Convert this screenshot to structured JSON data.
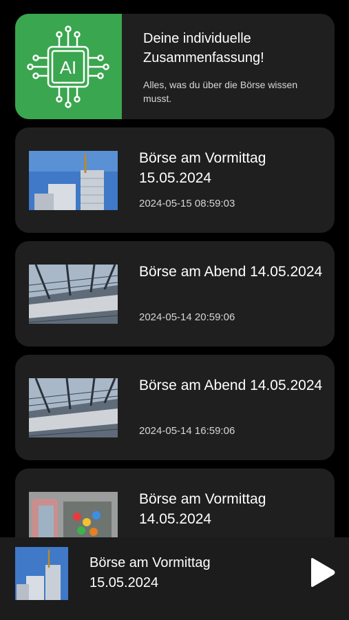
{
  "ai_card": {
    "title": "Deine individuelle Zusammenfassung!",
    "subtitle": "Alles, was du über die Börse wissen musst.",
    "chip_label": "AI",
    "accent_color": "#3aa64f"
  },
  "episodes": [
    {
      "title": "Börse am Vormittag 15.05.2024",
      "timestamp": "2024-05-15 08:59:03",
      "thumbnail": "tower-icon"
    },
    {
      "title": "Börse am Abend 14.05.2024",
      "timestamp": "2024-05-14 20:59:06",
      "thumbnail": "rheinmetall-building-icon"
    },
    {
      "title": "Börse am Abend 14.05.2024",
      "timestamp": "2024-05-14 16:59:06",
      "thumbnail": "rheinmetall-building-icon"
    },
    {
      "title": "Börse am Vormittag 14.05.2024",
      "timestamp": "",
      "thumbnail": "shopping-cart-icon"
    }
  ],
  "player": {
    "title": "Börse am Vormittag 15.05.2024",
    "thumbnail": "tower-icon",
    "control": "play-icon"
  }
}
